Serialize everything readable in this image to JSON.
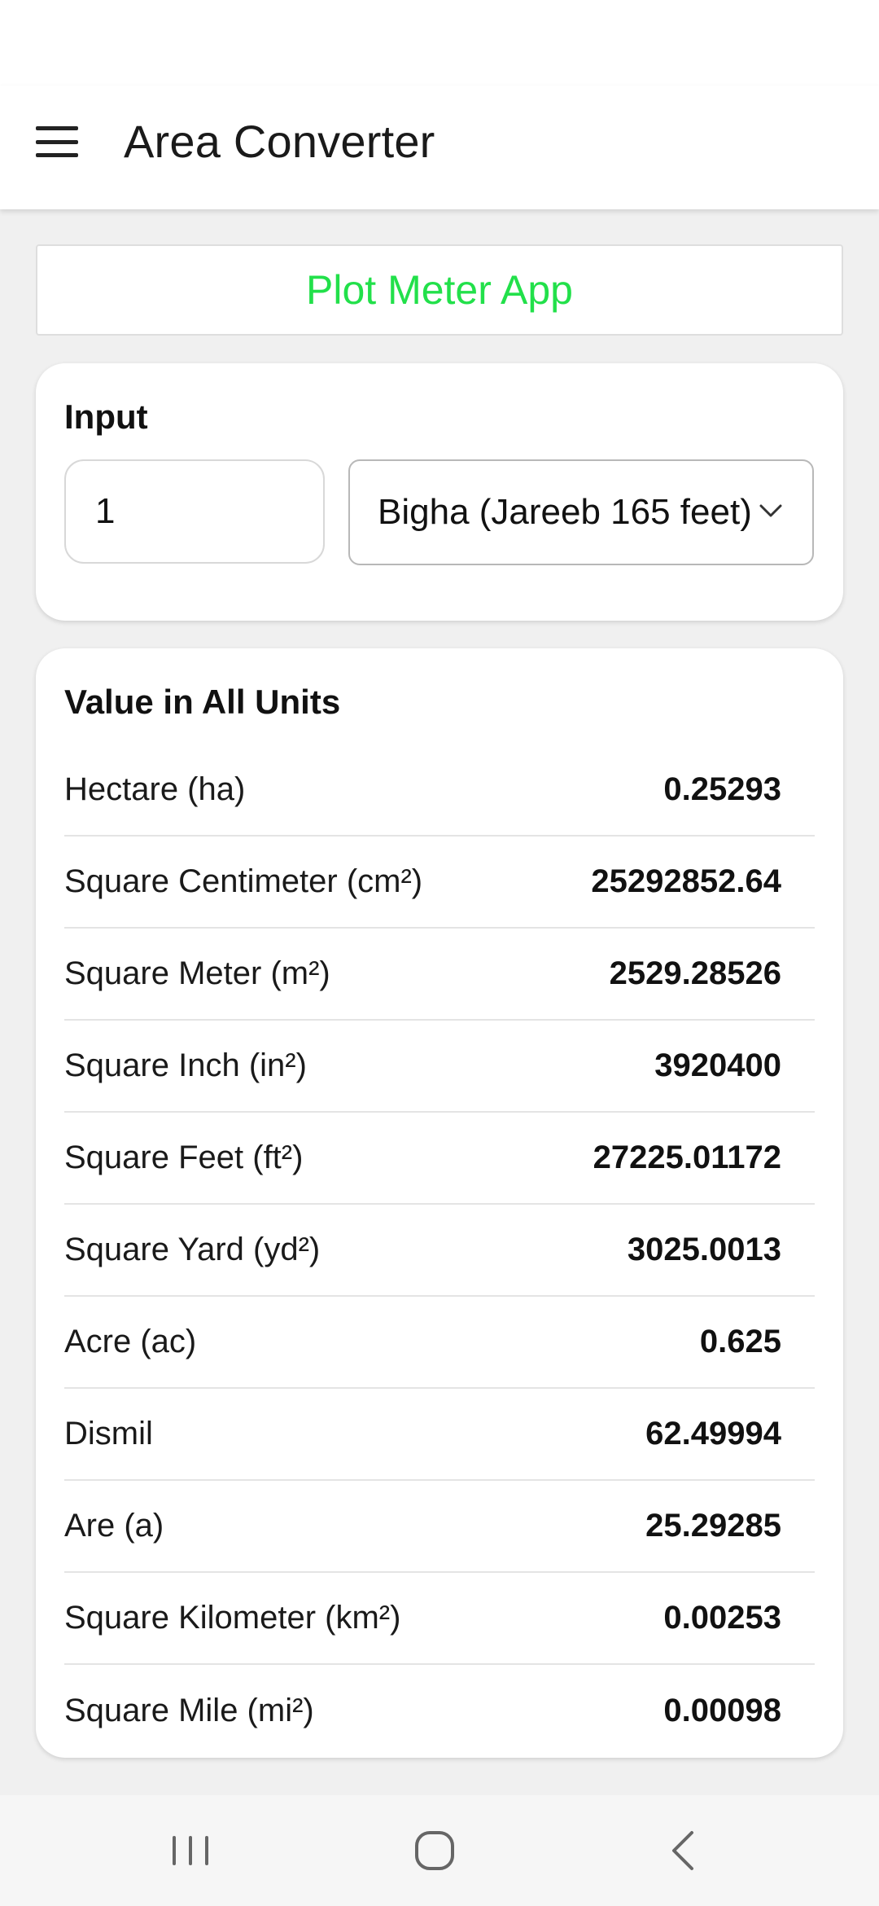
{
  "app_bar": {
    "title": "Area Converter",
    "menu_icon": "hamburger-menu-icon"
  },
  "promo": {
    "label": "Plot Meter App",
    "color": "#22e04a"
  },
  "input_card": {
    "title": "Input",
    "value": "1",
    "selected_unit": "Bigha (Jareeb 165 feet)",
    "dropdown_icon": "chevron-down-icon"
  },
  "results_card": {
    "title": "Value in All Units",
    "rows": [
      {
        "label": "Hectare (ha)",
        "value": "0.25293"
      },
      {
        "label": "Square Centimeter (cm²)",
        "value": "25292852.64"
      },
      {
        "label": "Square Meter (m²)",
        "value": "2529.28526"
      },
      {
        "label": "Square Inch (in²)",
        "value": "3920400"
      },
      {
        "label": "Square Feet (ft²)",
        "value": "27225.01172"
      },
      {
        "label": "Square Yard (yd²)",
        "value": "3025.0013"
      },
      {
        "label": "Acre (ac)",
        "value": "0.625"
      },
      {
        "label": "Dismil",
        "value": "62.49994"
      },
      {
        "label": "Are (a)",
        "value": "25.29285"
      },
      {
        "label": "Square Kilometer (km²)",
        "value": "0.00253"
      },
      {
        "label": "Square Mile (mi²)",
        "value": "0.00098"
      }
    ]
  },
  "nav_bar": {
    "recents_icon": "recents-icon",
    "home_icon": "home-icon",
    "back_icon": "back-icon"
  }
}
